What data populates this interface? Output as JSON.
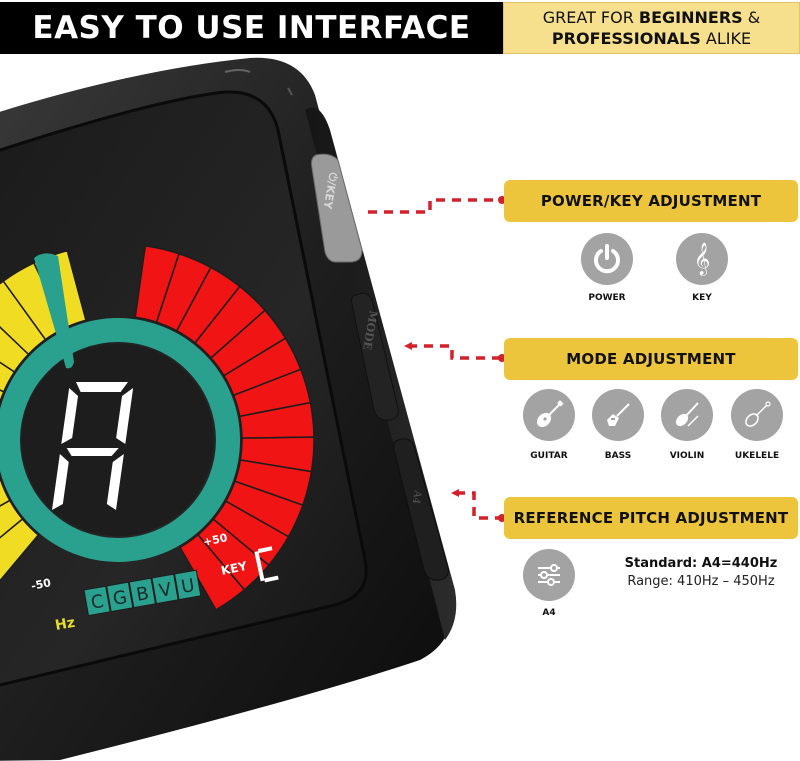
{
  "header": {
    "title": "EASY TO USE INTERFACE",
    "tagline_line1_pre": "GREAT FOR ",
    "tagline_line1_bold": "BEGINNERS",
    "tagline_line1_post": " &",
    "tagline_line2_bold": "PROFESSIONALS",
    "tagline_line2_post": " ALIKE"
  },
  "device": {
    "note": "A",
    "reference_hz": "440",
    "hz_unit": "Hz",
    "minus_label": "-50",
    "plus_label": "+50",
    "key_label": "KEY",
    "key_value": "C",
    "modes": [
      "C",
      "G",
      "B",
      "V",
      "U"
    ],
    "side_buttons": {
      "power_key": "⏻/KEY",
      "mode": "MODE",
      "pitch": "A4"
    }
  },
  "callouts": [
    {
      "title": "POWER/KEY ADJUSTMENT",
      "icons": [
        {
          "icon": "power-icon",
          "label": "POWER"
        },
        {
          "icon": "treble-clef-icon",
          "label": "KEY"
        }
      ]
    },
    {
      "title": "MODE ADJUSTMENT",
      "icons": [
        {
          "icon": "acoustic-guitar-icon",
          "label": "GUITAR"
        },
        {
          "icon": "electric-bass-icon",
          "label": "BASS"
        },
        {
          "icon": "violin-icon",
          "label": "VIOLIN"
        },
        {
          "icon": "ukulele-icon",
          "label": "UKELELE"
        }
      ]
    },
    {
      "title": "REFERENCE PITCH ADJUSTMENT",
      "icons": [
        {
          "icon": "sliders-icon",
          "label": "A4"
        }
      ],
      "standard": "Standard: A4=440Hz",
      "range": "Range: 410Hz – 450Hz"
    }
  ],
  "colors": {
    "banner": "#ecc53c",
    "header_bar": "#000000",
    "header_tag_bg": "#f6e08e",
    "leader_line": "#d3202a",
    "icon_circle": "#a3a3a3",
    "teal": "#2aa18e",
    "red_segments": "#f01414",
    "yellow_segments": "#f0dc22"
  }
}
